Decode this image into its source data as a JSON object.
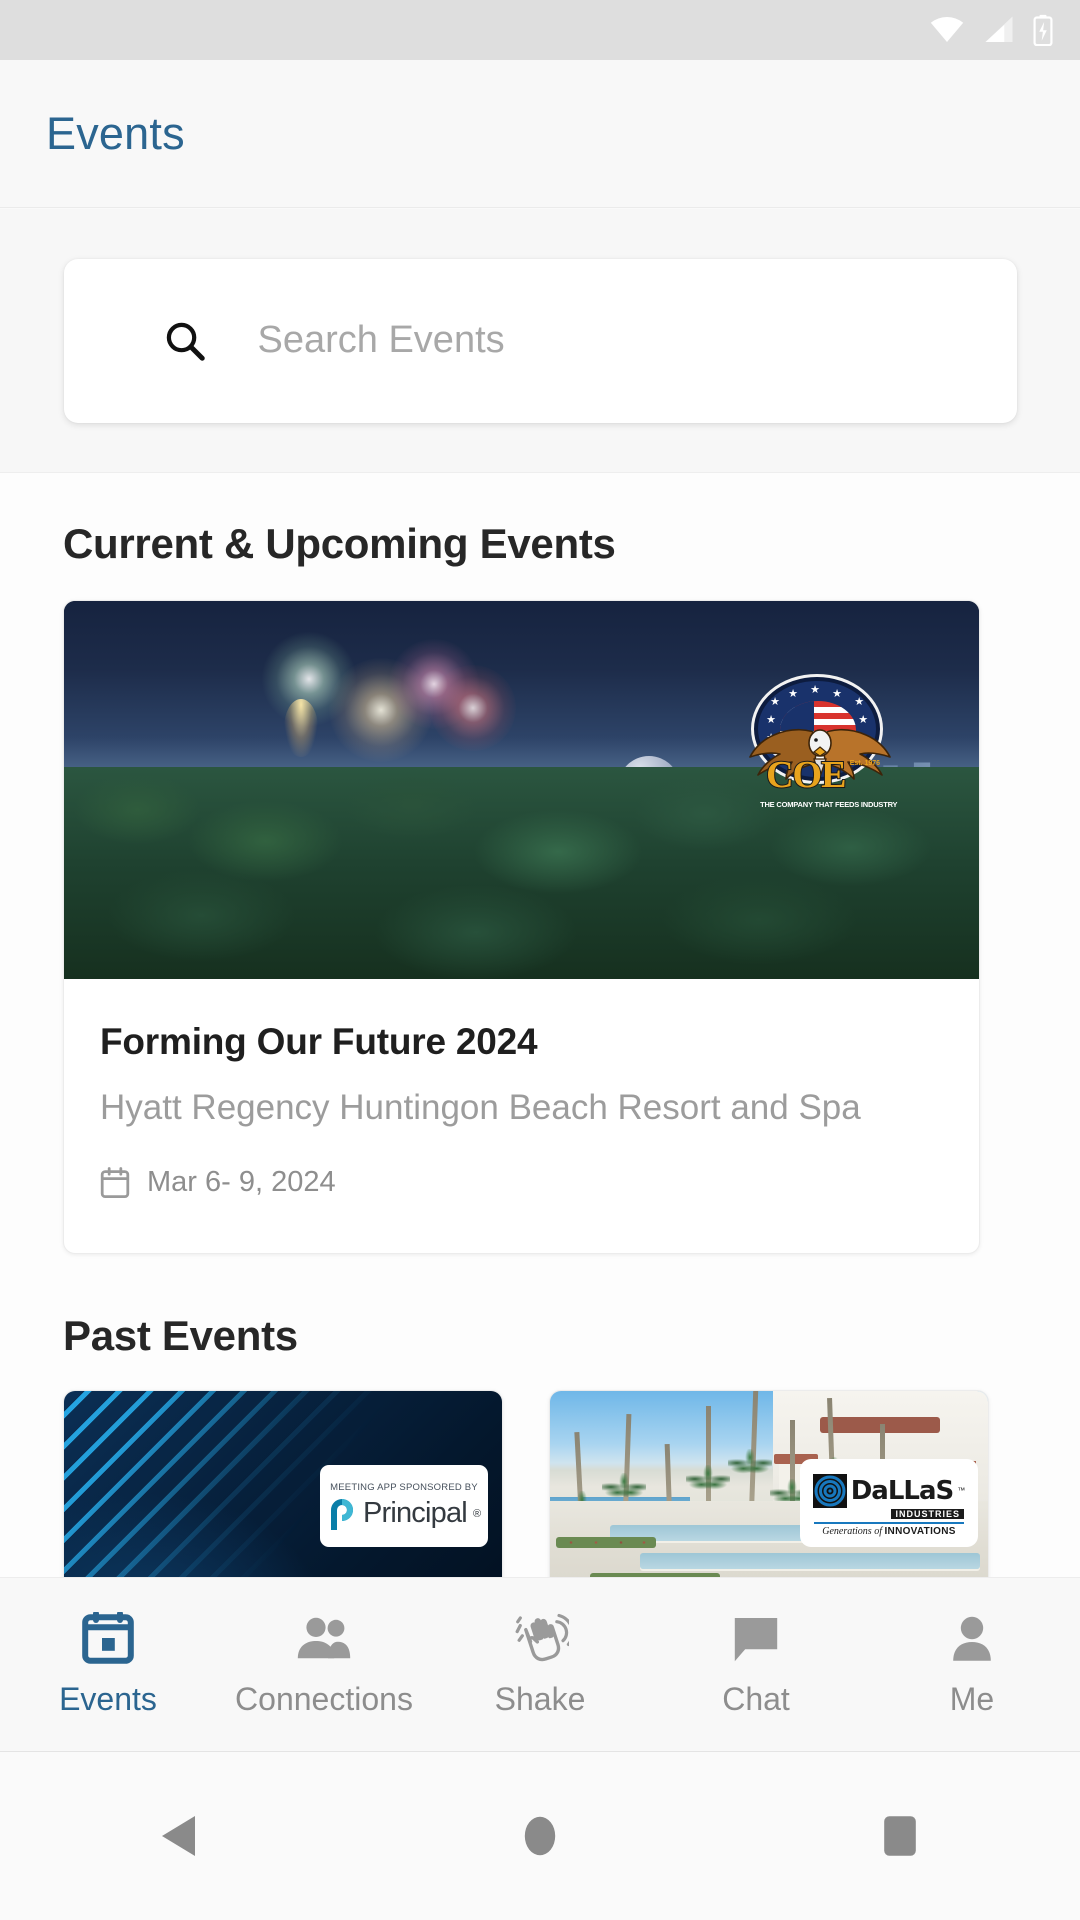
{
  "status_bar": {
    "icons": [
      "wifi-icon",
      "cellular-signal-icon",
      "battery-charging-icon"
    ],
    "background": "#dedede",
    "icon_color": "#ffffff"
  },
  "app_bar": {
    "title": "Events",
    "title_color": "#2b6590",
    "background": "#f8f8f8"
  },
  "search": {
    "icon": "search-icon",
    "placeholder": "Search Events",
    "value": ""
  },
  "sections": {
    "current": {
      "heading": "Current & Upcoming Events",
      "events": [
        {
          "title": "Forming Our Future 2024",
          "venue": "Hyatt Regency Huntingon Beach Resort and Spa",
          "date": "Mar  6- 9, 2024",
          "date_icon": "calendar-icon",
          "image": "forest-canopy-fireworks-at-dusk",
          "logo": {
            "name": "coe-logo",
            "word": "COE",
            "tagline": "THE COMPANY THAT FEEDS INDUSTRY",
            "established": "Est. 1976"
          }
        }
      ]
    },
    "past": {
      "heading": "Past Events",
      "events": [
        {
          "image": "navy-background-with-cyan-diagonal-stripes",
          "badge": {
            "name": "principal-sponsor-badge",
            "kicker": "MEETING APP SPONSORED BY",
            "brand": "Principal",
            "registered_mark": "®"
          }
        },
        {
          "image": "beach-resort-with-palm-trees-and-fountains",
          "badge": {
            "name": "dallas-industries-logo",
            "brand": "DaLLaS",
            "trademark": "™",
            "sub": "INDUSTRIES",
            "tagline_italic": "Generations of ",
            "tagline_bold": "INNOVATIONS"
          }
        }
      ]
    }
  },
  "bottom_nav": {
    "active_color": "#2b6590",
    "inactive_color": "#8d8d8d",
    "items": [
      {
        "label": "Events",
        "icon": "calendar-event-icon",
        "active": true
      },
      {
        "label": "Connections",
        "icon": "people-icon",
        "active": false
      },
      {
        "label": "Shake",
        "icon": "shake-hand-icon",
        "active": false
      },
      {
        "label": "Chat",
        "icon": "chat-bubble-icon",
        "active": false
      },
      {
        "label": "Me",
        "icon": "person-icon",
        "active": false
      }
    ]
  },
  "android_nav": {
    "buttons": [
      {
        "name": "back-button",
        "icon": "triangle-left-icon"
      },
      {
        "name": "home-button",
        "icon": "circle-icon"
      },
      {
        "name": "recents-button",
        "icon": "square-icon"
      }
    ],
    "color": "#8a8a8a"
  }
}
